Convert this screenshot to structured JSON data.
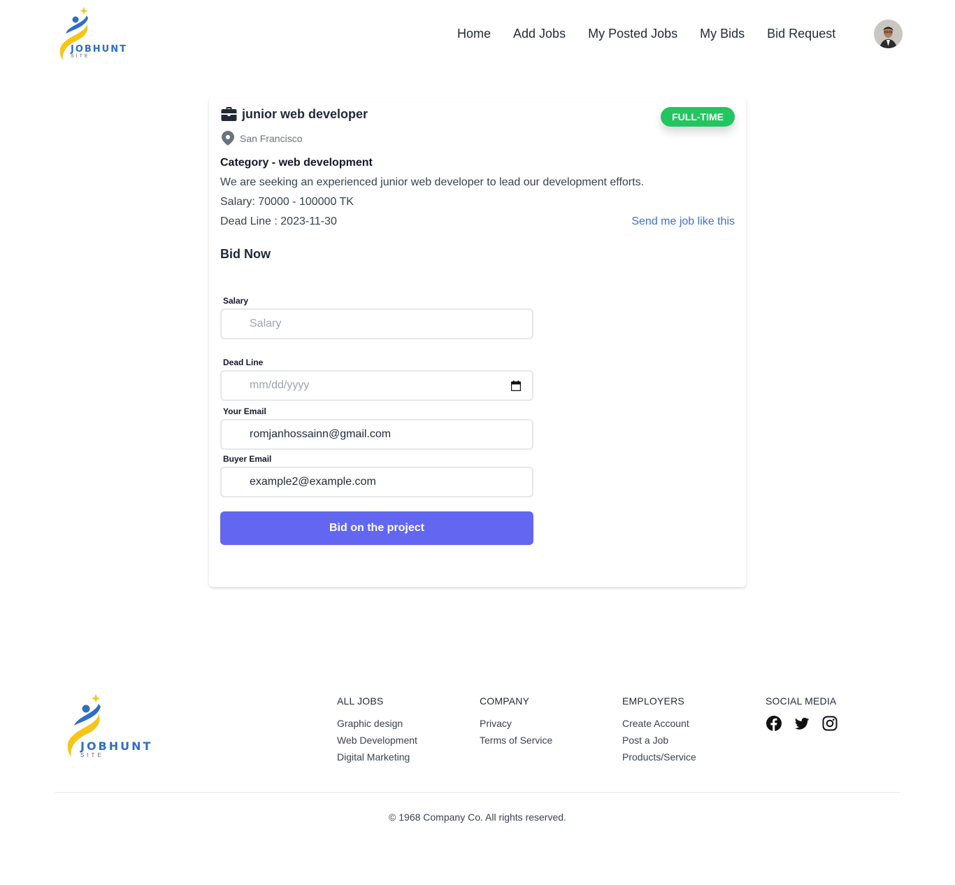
{
  "header": {
    "logo_text": "JOBHUNT",
    "logo_sub": "SITE",
    "nav": [
      "Home",
      "Add Jobs",
      "My Posted Jobs",
      "My Bids",
      "Bid Request"
    ]
  },
  "job": {
    "title": "junior web developer",
    "location": "San Francisco",
    "badge": "FULL-TIME",
    "category": "Category - web development",
    "description": "We are seeking an experienced junior web developer to lead our development efforts.",
    "salary": "Salary: 70000 - 100000 TK",
    "deadline": "Dead Line : 2023-11-30",
    "send_link": "Send me job like this"
  },
  "bid_form": {
    "heading": "Bid Now",
    "salary_label": "Salary",
    "salary_placeholder": "Salary",
    "deadline_label": "Dead Line",
    "deadline_placeholder": "mm/dd/yyyy",
    "email_label": "Your Email",
    "email_value": "romjanhossainn@gmail.com",
    "buyer_label": "Buyer Email",
    "buyer_value": "example2@example.com",
    "submit_label": "Bid on the project"
  },
  "footer": {
    "logo_text": "JOBHUNT",
    "logo_sub": "SITE",
    "columns": [
      {
        "title": "ALL JOBS",
        "links": [
          "Graphic design",
          "Web Development",
          "Digital Marketing"
        ]
      },
      {
        "title": "COMPANY",
        "links": [
          "Privacy",
          "Terms of Service"
        ]
      },
      {
        "title": "EMPLOYERS",
        "links": [
          "Create Account",
          "Post a Job",
          "Products/Service"
        ]
      },
      {
        "title": "SOCIAL MEDIA",
        "icons": [
          "facebook-icon",
          "twitter-icon",
          "instagram-icon"
        ]
      }
    ],
    "copyright": "© 1968 Company Co. All rights reserved."
  },
  "colors": {
    "brand_blue": "#2f6ec4",
    "brand_yellow": "#f5c518",
    "badge_green": "#22c55e",
    "button_indigo": "#6366f1",
    "link_blue": "#3b6fd4"
  }
}
